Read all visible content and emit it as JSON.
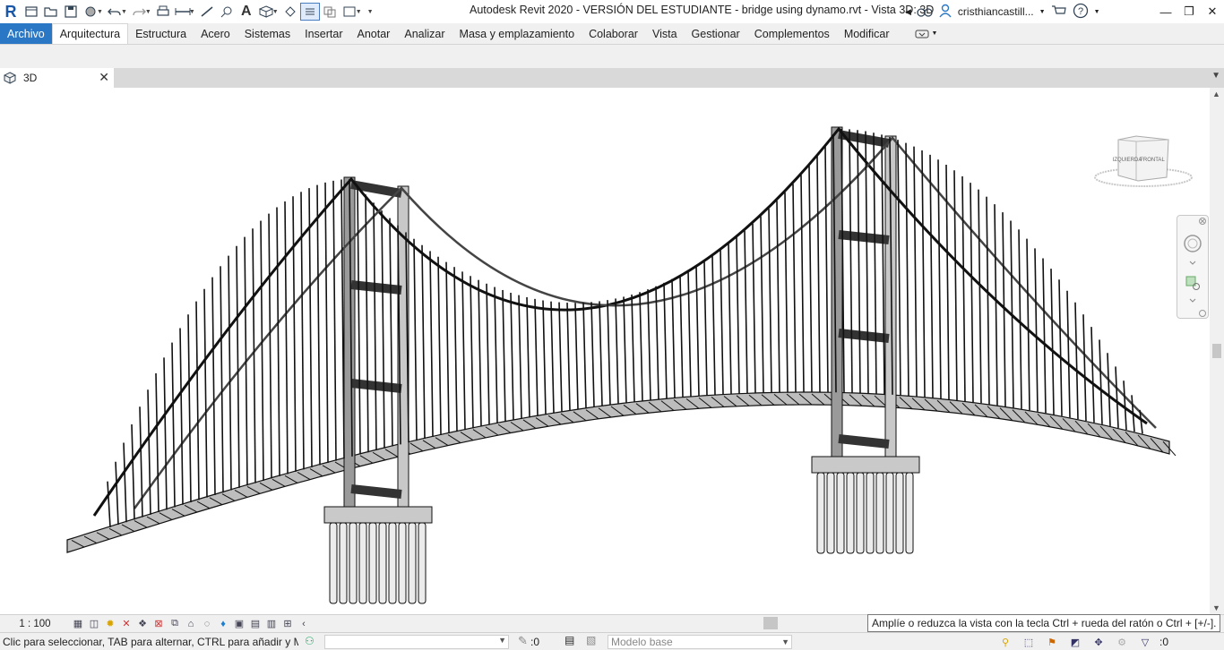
{
  "titlebar": {
    "app_logo": "R",
    "title": "Autodesk Revit 2020 - VERSIÓN DEL ESTUDIANTE - bridge using dynamo.rvt - Vista 3D: 3D",
    "username": "cristhiancastill...",
    "quick_access_icons": [
      "home-icon",
      "open-icon",
      "save-icon",
      "sync-icon",
      "undo-icon",
      "redo-icon",
      "print-icon",
      "measure-icon",
      "dimension-icon",
      "tag-icon",
      "text-icon",
      "3d-view-icon",
      "section-icon",
      "thin-lines-icon",
      "close-hidden-icon",
      "switch-windows-icon"
    ]
  },
  "ribbon": {
    "tabs": [
      {
        "label": "Archivo"
      },
      {
        "label": "Arquitectura"
      },
      {
        "label": "Estructura"
      },
      {
        "label": "Acero"
      },
      {
        "label": "Sistemas"
      },
      {
        "label": "Insertar"
      },
      {
        "label": "Anotar"
      },
      {
        "label": "Analizar"
      },
      {
        "label": "Masa y emplazamiento"
      },
      {
        "label": "Colaborar"
      },
      {
        "label": "Vista"
      },
      {
        "label": "Gestionar"
      },
      {
        "label": "Complementos"
      },
      {
        "label": "Modificar"
      }
    ],
    "active_tab": "Arquitectura"
  },
  "view_tab": {
    "label": "3D",
    "close": "✕"
  },
  "viewcube": {
    "left_face": "IZQUIERDA",
    "front_face": "FRONTAL"
  },
  "view_control": {
    "scale": "1 : 100"
  },
  "tooltip": {
    "text": "Amplíe o reduzca la vista con la tecla Ctrl + rueda del ratón o Ctrl + [+/-]."
  },
  "statusbar": {
    "text": "Clic para seleccionar, TAB para alternar, CTRL para añadir y MAYÚS para anular selección.",
    "edit_requests": ":0",
    "design_option": "Modelo base",
    "filter_count": ":0"
  },
  "colors": {
    "file_tab": "#2a78c5",
    "ribbon_bg": "#f0f0f0",
    "tab_strip": "#d9d9d9"
  }
}
